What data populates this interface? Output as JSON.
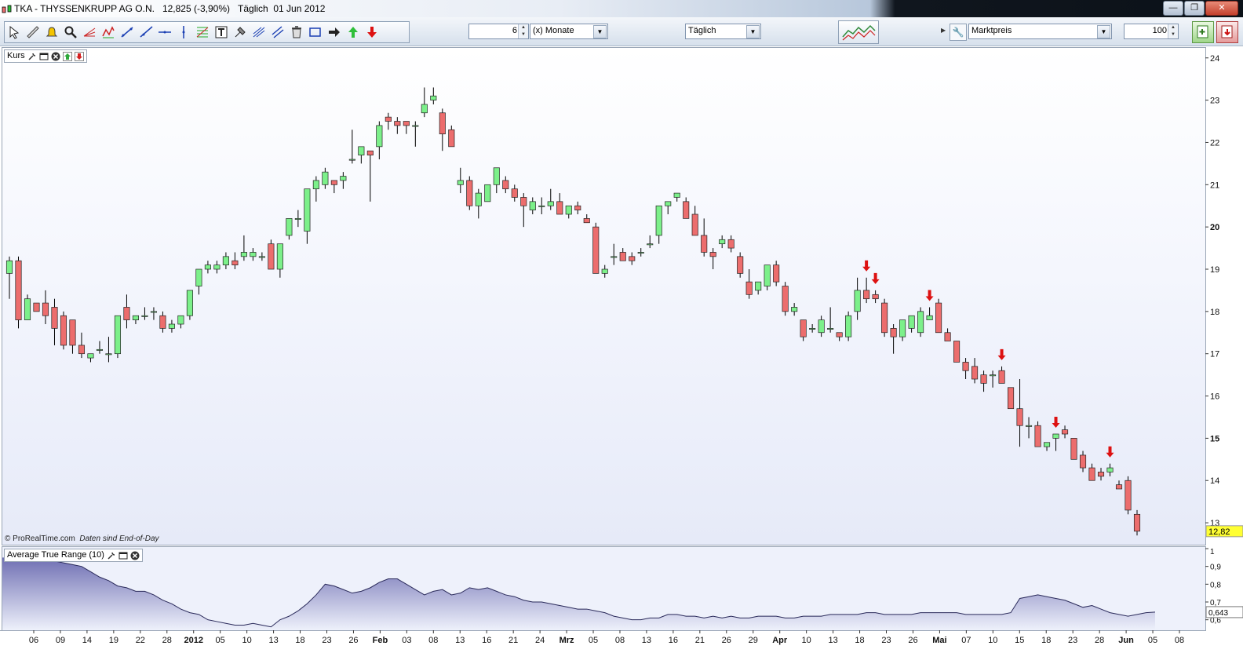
{
  "window": {
    "ticker": "TKA - THYSSENKRUPP AG O.N.",
    "price_change": "12,825 (-3,90%)",
    "interval_date": "Täglich  01 Jun 2012",
    "buttons": [
      "minimize",
      "restore",
      "close"
    ]
  },
  "toolbar": {
    "tools": [
      "cursor-icon",
      "ruler-icon",
      "alarm-bell-icon",
      "zoom-icon",
      "fibonacci-fan-icon",
      "pattern-icon",
      "trendline-icon",
      "ray-icon",
      "horizontal-line-icon",
      "vertical-line-icon",
      "fibonacci-retracement-icon",
      "text-icon",
      "gann-tools-icon",
      "regression-icon",
      "channel-icon",
      "trash-icon",
      "rectangle-icon",
      "arrow-right-icon",
      "buy-arrow-icon",
      "sell-arrow-icon"
    ],
    "period_value": "6",
    "period_unit": "(x) Monate",
    "interval": "Täglich",
    "price_type": "Marktpreis",
    "zoom_value": "100"
  },
  "main_panel": {
    "label": "Kurs",
    "footer_source": "© ProRealTime.com",
    "footer_note": "Daten sind End-of-Day",
    "last_price_tag": "12,82",
    "y_ticks": [
      "24",
      "23",
      "22",
      "21",
      "20",
      "19",
      "18",
      "17",
      "16",
      "15",
      "14",
      "13"
    ]
  },
  "atr_panel": {
    "label": "Average True Range (10)",
    "last_value_tag": "0,643",
    "y_ticks": [
      "1",
      "0,9",
      "0,8",
      "0,7",
      "0,6"
    ]
  },
  "x_axis": {
    "labels": [
      "06",
      "09",
      "14",
      "19",
      "22",
      "28",
      "2012",
      "05",
      "10",
      "13",
      "18",
      "23",
      "26",
      "Feb",
      "03",
      "08",
      "13",
      "16",
      "21",
      "24",
      "Mrz",
      "05",
      "08",
      "13",
      "16",
      "21",
      "26",
      "29",
      "Apr",
      "10",
      "13",
      "18",
      "23",
      "26",
      "Mai",
      "07",
      "10",
      "15",
      "18",
      "23",
      "28",
      "Jun",
      "05",
      "08"
    ]
  },
  "colors": {
    "up": "#7cf08a",
    "down": "#ec6d6d",
    "wick": "#000000",
    "atr_fill": "#6f6fb3",
    "signal_arrow": "#dd1111",
    "price_tag": "#ffff33"
  },
  "chart_data": {
    "type": "candlestick",
    "title": "TKA - THYSSENKRUPP AG O.N.",
    "ylim": [
      12.5,
      24.2
    ],
    "candles": [
      [
        18.9,
        19.3,
        18.3,
        19.2
      ],
      [
        19.2,
        19.3,
        17.6,
        17.8
      ],
      [
        17.8,
        18.4,
        17.8,
        18.3
      ],
      [
        18.2,
        18.2,
        18.0,
        18.0
      ],
      [
        18.2,
        18.5,
        17.7,
        17.9
      ],
      [
        18.1,
        18.3,
        17.2,
        17.6
      ],
      [
        17.9,
        18.0,
        17.1,
        17.2
      ],
      [
        17.8,
        17.8,
        17.0,
        17.2
      ],
      [
        17.2,
        17.5,
        16.9,
        17.0
      ],
      [
        16.9,
        17.0,
        16.8,
        17.0
      ],
      [
        17.1,
        17.3,
        17.0,
        17.1
      ],
      [
        17.0,
        17.4,
        16.8,
        17.0
      ],
      [
        17.0,
        17.9,
        16.9,
        17.9
      ],
      [
        18.1,
        18.4,
        17.6,
        17.8
      ],
      [
        17.8,
        17.9,
        17.7,
        17.9
      ],
      [
        17.9,
        18.1,
        17.8,
        17.9
      ],
      [
        18.0,
        18.1,
        17.8,
        18.0
      ],
      [
        17.9,
        18.0,
        17.5,
        17.6
      ],
      [
        17.6,
        17.8,
        17.5,
        17.7
      ],
      [
        17.7,
        17.9,
        17.6,
        17.9
      ],
      [
        17.9,
        18.5,
        17.8,
        18.5
      ],
      [
        18.6,
        19.0,
        18.4,
        19.0
      ],
      [
        19.0,
        19.2,
        18.9,
        19.1
      ],
      [
        19.0,
        19.2,
        18.9,
        19.1
      ],
      [
        19.1,
        19.4,
        19.0,
        19.3
      ],
      [
        19.2,
        19.4,
        19.0,
        19.1
      ],
      [
        19.3,
        19.8,
        19.2,
        19.4
      ],
      [
        19.3,
        19.5,
        19.2,
        19.4
      ],
      [
        19.3,
        19.4,
        19.2,
        19.3
      ],
      [
        19.6,
        19.7,
        19.0,
        19.0
      ],
      [
        19.0,
        19.6,
        18.8,
        19.6
      ],
      [
        19.8,
        20.2,
        19.7,
        20.2
      ],
      [
        20.2,
        20.4,
        20.0,
        20.2
      ],
      [
        19.9,
        20.9,
        19.6,
        20.9
      ],
      [
        20.9,
        21.2,
        20.6,
        21.1
      ],
      [
        21.0,
        21.4,
        20.9,
        21.3
      ],
      [
        21.1,
        21.1,
        20.8,
        21.0
      ],
      [
        21.1,
        21.3,
        20.9,
        21.2
      ],
      [
        21.6,
        22.3,
        21.5,
        21.6
      ],
      [
        21.7,
        21.9,
        21.5,
        21.9
      ],
      [
        21.8,
        21.8,
        20.6,
        21.7
      ],
      [
        21.9,
        22.5,
        21.6,
        22.4
      ],
      [
        22.6,
        22.7,
        22.3,
        22.5
      ],
      [
        22.5,
        22.6,
        22.2,
        22.4
      ],
      [
        22.5,
        22.5,
        22.2,
        22.4
      ],
      [
        22.4,
        22.5,
        21.9,
        22.4
      ],
      [
        22.7,
        23.3,
        22.6,
        22.9
      ],
      [
        23.0,
        23.3,
        22.9,
        23.1
      ],
      [
        22.7,
        22.8,
        21.8,
        22.2
      ],
      [
        22.3,
        22.4,
        21.9,
        21.9
      ],
      [
        21.0,
        21.4,
        20.8,
        21.1
      ],
      [
        21.1,
        21.2,
        20.4,
        20.5
      ],
      [
        20.5,
        20.9,
        20.2,
        20.8
      ],
      [
        20.6,
        20.9,
        20.6,
        21.0
      ],
      [
        21.0,
        21.4,
        20.8,
        21.4
      ],
      [
        21.1,
        21.2,
        20.8,
        20.9
      ],
      [
        20.9,
        21.0,
        20.6,
        20.7
      ],
      [
        20.7,
        20.8,
        20.0,
        20.5
      ],
      [
        20.4,
        20.7,
        20.3,
        20.6
      ],
      [
        20.5,
        20.7,
        20.3,
        20.5
      ],
      [
        20.5,
        20.9,
        20.4,
        20.6
      ],
      [
        20.6,
        20.8,
        20.3,
        20.3
      ],
      [
        20.3,
        20.5,
        20.2,
        20.5
      ],
      [
        20.5,
        20.6,
        20.3,
        20.4
      ],
      [
        20.2,
        20.3,
        20.1,
        20.1
      ],
      [
        20.0,
        20.1,
        18.9,
        18.9
      ],
      [
        18.9,
        19.1,
        18.8,
        19.0
      ],
      [
        19.3,
        19.6,
        19.1,
        19.3
      ],
      [
        19.4,
        19.5,
        19.2,
        19.2
      ],
      [
        19.3,
        19.4,
        19.1,
        19.2
      ],
      [
        19.4,
        19.5,
        19.3,
        19.4
      ],
      [
        19.6,
        19.8,
        19.5,
        19.6
      ],
      [
        19.8,
        20.5,
        19.6,
        20.5
      ],
      [
        20.5,
        20.6,
        20.3,
        20.6
      ],
      [
        20.7,
        20.8,
        20.6,
        20.8
      ],
      [
        20.6,
        20.7,
        20.2,
        20.2
      ],
      [
        20.3,
        20.5,
        19.8,
        19.8
      ],
      [
        19.8,
        20.2,
        19.3,
        19.4
      ],
      [
        19.4,
        19.5,
        19.0,
        19.3
      ],
      [
        19.6,
        19.8,
        19.5,
        19.7
      ],
      [
        19.7,
        19.8,
        19.4,
        19.5
      ],
      [
        19.3,
        19.4,
        18.8,
        18.9
      ],
      [
        18.7,
        19.0,
        18.3,
        18.4
      ],
      [
        18.5,
        18.7,
        18.4,
        18.7
      ],
      [
        18.6,
        19.0,
        18.5,
        19.1
      ],
      [
        19.1,
        19.2,
        18.6,
        18.7
      ],
      [
        18.6,
        18.7,
        17.9,
        18.0
      ],
      [
        18.0,
        18.2,
        17.9,
        18.1
      ],
      [
        17.8,
        17.8,
        17.3,
        17.4
      ],
      [
        17.6,
        17.7,
        17.5,
        17.6
      ],
      [
        17.5,
        17.9,
        17.4,
        17.8
      ],
      [
        17.6,
        18.1,
        17.5,
        17.6
      ],
      [
        17.5,
        17.5,
        17.3,
        17.4
      ],
      [
        17.4,
        18.0,
        17.3,
        17.9
      ],
      [
        18.0,
        18.8,
        17.8,
        18.5
      ],
      [
        18.5,
        18.8,
        18.2,
        18.3
      ],
      [
        18.4,
        18.5,
        18.2,
        18.3
      ],
      [
        18.2,
        18.3,
        17.4,
        17.5
      ],
      [
        17.6,
        17.7,
        17.0,
        17.4
      ],
      [
        17.4,
        17.8,
        17.3,
        17.8
      ],
      [
        17.6,
        17.9,
        17.5,
        17.9
      ],
      [
        17.5,
        18.1,
        17.4,
        18.0
      ],
      [
        17.8,
        18.1,
        17.8,
        17.9
      ],
      [
        18.2,
        18.3,
        17.5,
        17.5
      ],
      [
        17.5,
        17.6,
        17.4,
        17.3
      ],
      [
        17.3,
        17.3,
        16.8,
        16.8
      ],
      [
        16.8,
        16.9,
        16.4,
        16.6
      ],
      [
        16.7,
        16.9,
        16.3,
        16.4
      ],
      [
        16.5,
        16.6,
        16.1,
        16.3
      ],
      [
        16.5,
        16.6,
        16.2,
        16.5
      ],
      [
        16.6,
        16.7,
        16.3,
        16.3
      ],
      [
        16.2,
        16.2,
        15.8,
        15.7
      ],
      [
        15.7,
        16.4,
        14.8,
        15.3
      ],
      [
        15.3,
        15.5,
        15.0,
        15.3
      ],
      [
        15.3,
        15.4,
        14.8,
        14.8
      ],
      [
        14.8,
        14.9,
        14.7,
        14.9
      ],
      [
        15.0,
        15.1,
        14.7,
        15.1
      ],
      [
        15.2,
        15.3,
        15.0,
        15.1
      ],
      [
        15.0,
        15.0,
        14.5,
        14.5
      ],
      [
        14.6,
        14.7,
        14.2,
        14.3
      ],
      [
        14.3,
        14.4,
        14.0,
        14.0
      ],
      [
        14.2,
        14.3,
        14.0,
        14.1
      ],
      [
        14.2,
        14.4,
        14.1,
        14.3
      ],
      [
        13.9,
        14.0,
        13.8,
        13.8
      ],
      [
        14.0,
        14.1,
        13.2,
        13.3
      ],
      [
        13.2,
        13.3,
        12.7,
        12.8
      ]
    ],
    "signals": [
      {
        "index": 95,
        "type": "sell"
      },
      {
        "index": 96,
        "type": "sell"
      },
      {
        "index": 102,
        "type": "sell"
      },
      {
        "index": 110,
        "type": "sell"
      },
      {
        "index": 116,
        "type": "sell"
      },
      {
        "index": 122,
        "type": "sell"
      }
    ],
    "atr": {
      "name": "Average True Range (10)",
      "ylim": [
        0.55,
        1.0
      ],
      "values": [
        0.95,
        0.95,
        0.94,
        0.94,
        0.93,
        0.93,
        0.92,
        0.91,
        0.9,
        0.87,
        0.84,
        0.82,
        0.79,
        0.78,
        0.76,
        0.76,
        0.74,
        0.71,
        0.69,
        0.66,
        0.64,
        0.63,
        0.6,
        0.59,
        0.58,
        0.57,
        0.57,
        0.58,
        0.57,
        0.56,
        0.6,
        0.62,
        0.65,
        0.69,
        0.74,
        0.8,
        0.79,
        0.77,
        0.75,
        0.76,
        0.78,
        0.81,
        0.83,
        0.83,
        0.8,
        0.77,
        0.74,
        0.76,
        0.77,
        0.74,
        0.75,
        0.78,
        0.77,
        0.78,
        0.76,
        0.74,
        0.73,
        0.71,
        0.7,
        0.7,
        0.69,
        0.68,
        0.67,
        0.66,
        0.66,
        0.65,
        0.64,
        0.62,
        0.61,
        0.6,
        0.6,
        0.61,
        0.61,
        0.63,
        0.63,
        0.62,
        0.62,
        0.61,
        0.62,
        0.61,
        0.62,
        0.61,
        0.61,
        0.62,
        0.62,
        0.62,
        0.61,
        0.61,
        0.62,
        0.62,
        0.62,
        0.63,
        0.63,
        0.63,
        0.63,
        0.64,
        0.64,
        0.63,
        0.63,
        0.63,
        0.63,
        0.64,
        0.64,
        0.64,
        0.64,
        0.64,
        0.63,
        0.63,
        0.63,
        0.63,
        0.63,
        0.64,
        0.72,
        0.73,
        0.74,
        0.73,
        0.72,
        0.71,
        0.69,
        0.67,
        0.68,
        0.66,
        0.64,
        0.63,
        0.62,
        0.63,
        0.64,
        0.643
      ]
    }
  }
}
